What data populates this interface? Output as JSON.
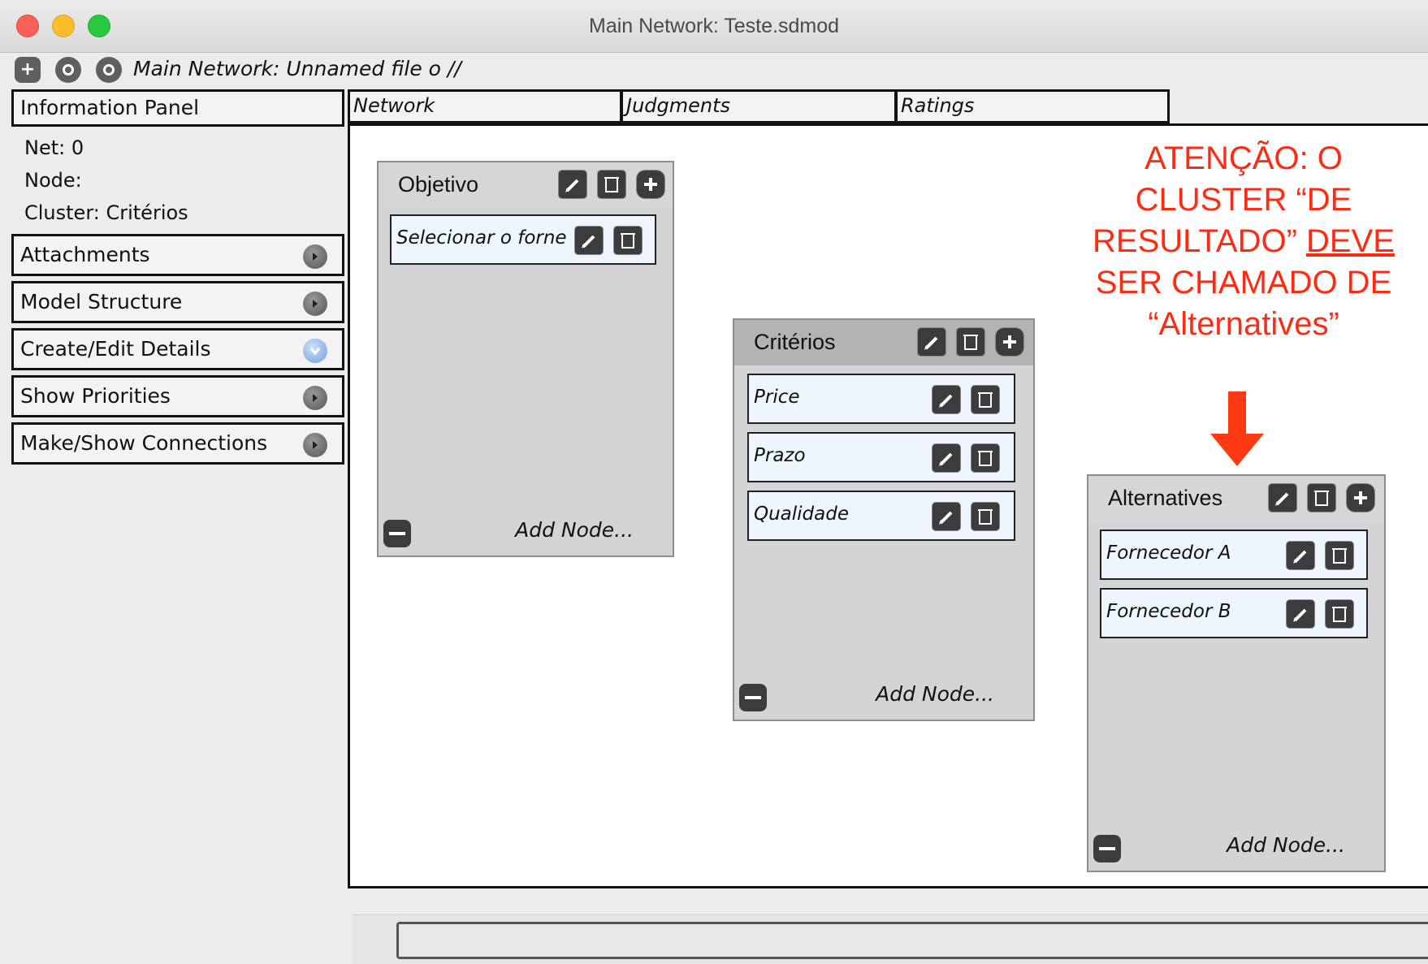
{
  "window": {
    "title": "Main Network: Teste.sdmod"
  },
  "toolbar": {
    "path_label": "Main Network: Unnamed file o //"
  },
  "info_panel": {
    "header": "Information Panel",
    "net": "Net: 0",
    "node": "Node:",
    "cluster": "Cluster: Critérios"
  },
  "accordion": [
    {
      "label": "Attachments",
      "state": "collapsed"
    },
    {
      "label": "Model Structure",
      "state": "collapsed"
    },
    {
      "label": "Create/Edit Details",
      "state": "expanded"
    },
    {
      "label": "Show Priorities",
      "state": "collapsed"
    },
    {
      "label": "Make/Show Connections",
      "state": "collapsed"
    }
  ],
  "tabs": [
    "Network",
    "Judgments",
    "Ratings"
  ],
  "clusters": [
    {
      "title": "Objetivo",
      "nodes": [
        "Selecionar o forne"
      ],
      "add_node": "Add Node..."
    },
    {
      "title": "Critérios",
      "nodes": [
        "Price",
        "Prazo",
        "Qualidade"
      ],
      "add_node": "Add Node..."
    },
    {
      "title": "Alternatives",
      "nodes": [
        "Fornecedor A",
        "Fornecedor B"
      ],
      "add_node": "Add Node..."
    }
  ],
  "annotation": {
    "line1": "ATENÇÃO: O",
    "line2": "CLUSTER “DE",
    "line3a": "RESULTADO” ",
    "line3b": "DEVE",
    "line4": "SER CHAMADO DE",
    "line5": "“Alternatives”",
    "color": "#ff2a12"
  },
  "icons": {
    "edit": "pencil-icon",
    "delete": "trash-icon",
    "add": "plus-icon",
    "collapse": "minus-icon"
  }
}
